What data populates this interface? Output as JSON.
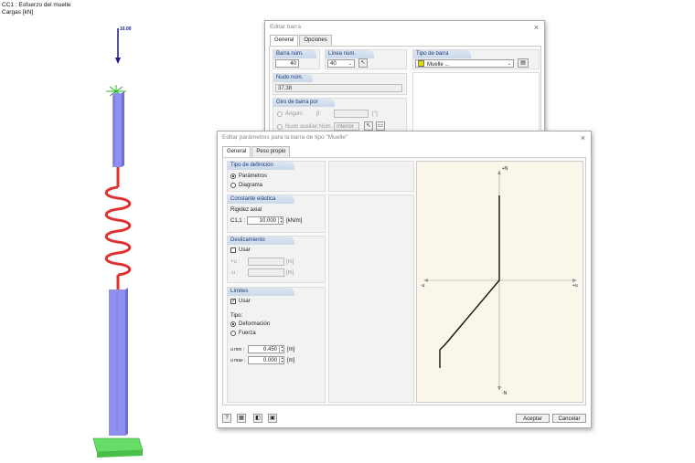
{
  "viewport": {
    "title_line1": "CC1 : Esfuerzo del muelle",
    "title_line2": "Cargas [kN]",
    "load_value": "10.00"
  },
  "editar_barra": {
    "title": "Editar barra",
    "tabs": [
      "General",
      "Opciones"
    ],
    "barra_num_label": "Barra núm.",
    "barra_num_value": "40",
    "linea_num_label": "Línea núm.",
    "linea_num_value": "40",
    "tipo_barra_label": "Tipo de barra",
    "tipo_barra_value": "Muelle ...",
    "nudo_num_label": "Nudo núm.",
    "nudo_num_value": "37,38",
    "giro_label": "Giro de barra por",
    "angulo_label": "Ángulo",
    "beta_label": "β:",
    "nudo_aux_label": "Nudo auxiliar:",
    "num_label": "Núm.",
    "interior_value": "Interior"
  },
  "editar_param": {
    "title": "Editar parámetros para la barra de tipo \"Muelle\"",
    "tabs": [
      "General",
      "Peso propio"
    ],
    "tipo_def_label": "Tipo de definición",
    "parametros_label": "Parámetros",
    "diagrama_label": "Diagrama",
    "const_elastica_label": "Constante elástica",
    "rigidez_label": "Rigidez axial",
    "c11_label": "C1,1 :",
    "c11_value": "10.000",
    "c11_unit": "[kN/m]",
    "deslizamiento_label": "Deslizamiento",
    "usar_label": "Usar",
    "slip_minus_label": "+u :",
    "slip_plus_label": "-u :",
    "slip_unit": "[m]",
    "limites_label": "Límites",
    "usar2_label": "Usar",
    "tipo_label": "Tipo:",
    "deformacion_label": "Deformación",
    "fuerza_label": "Fuerza",
    "umin_label": "u min :",
    "umin_value": "0.450",
    "umax_label": "u max :",
    "umax_value": "0.000",
    "unit_m": "[m]",
    "diagram_top": "+N",
    "diagram_bottom": "-N",
    "diagram_left": "-u",
    "diagram_right": "+u",
    "aceptar_label": "Aceptar",
    "cancelar_label": "Cancelar"
  },
  "colors": {
    "member": "#8f8ff0",
    "spring": "#e03030",
    "support": "#66dd66",
    "header_text": "#1a3d7a",
    "diagram_bg": "#faf6ea"
  }
}
